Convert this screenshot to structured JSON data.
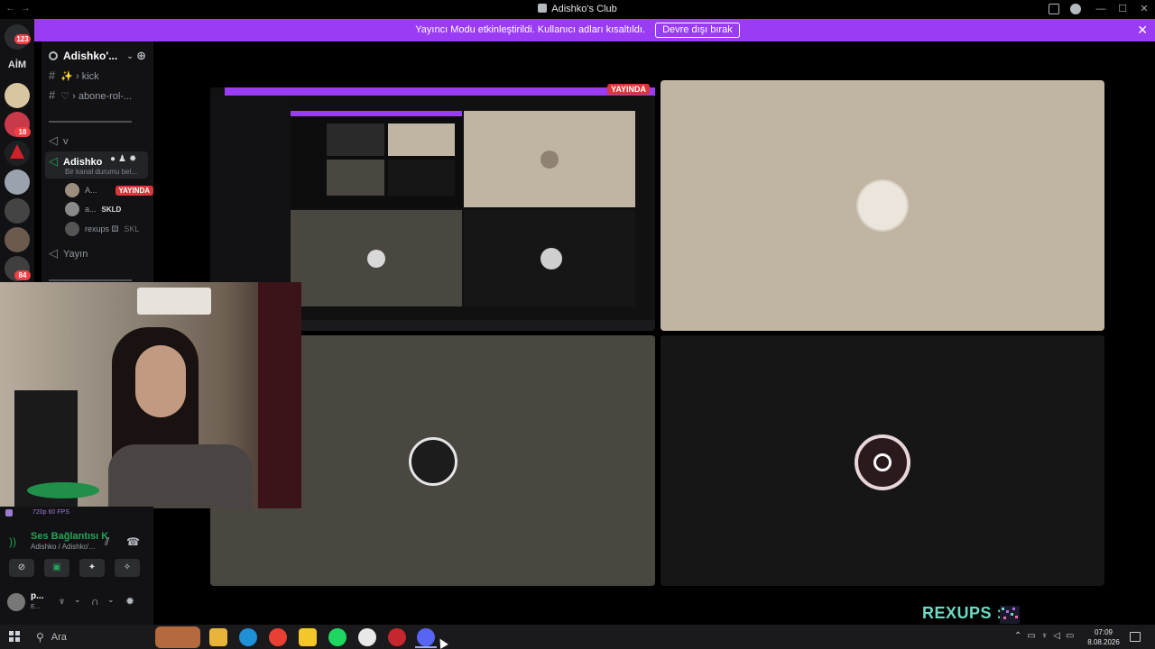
{
  "window": {
    "title": "Adishko's Club",
    "controls": [
      "minimize",
      "maximize",
      "close"
    ]
  },
  "banner": {
    "message": "Yayıncı Modu etkinleştirildi. Kullanıcı adları kısaltıldı.",
    "button_label": "Devre dışı bırak",
    "close_glyph": "✕"
  },
  "rail": {
    "home_badge": "123",
    "aim_label": "AİM",
    "badge_18": "18",
    "badge_84": "84"
  },
  "server": {
    "name": "Adishko'...",
    "channels": [
      {
        "icon": "hash-icon",
        "label": "✨ › kick"
      },
      {
        "icon": "hash-icon",
        "label": "♡ › abone-rol-..."
      }
    ],
    "category_v": "v",
    "voice_channel": {
      "name": "Adishko",
      "status": "Bir kanal durumu bel...",
      "users": [
        {
          "name": "A...",
          "badge": "YAYINDA"
        },
        {
          "name": "a...",
          "badge": "SKLD"
        },
        {
          "name": "rexups ⚄",
          "badge": "SKL"
        }
      ]
    },
    "stage_channel": "Yayın"
  },
  "voice_panel": {
    "quality": "720p 60 FPS",
    "status": "Ses Bağlantısı K",
    "location": "Adishko / Adishko'...",
    "user_name": "p...",
    "user_sub": "E..."
  },
  "screenshare": {
    "live_tag": "YAYINDA"
  },
  "watermark": {
    "text": "REXUPS :"
  },
  "taskbar": {
    "search_placeholder": "Ara",
    "time": "07:09",
    "date": "8.08.2026"
  },
  "colors": {
    "banner": "#9b3cf5",
    "live_red": "#da373c",
    "online_green": "#23a55a",
    "watermark": "#6fd9c4"
  }
}
